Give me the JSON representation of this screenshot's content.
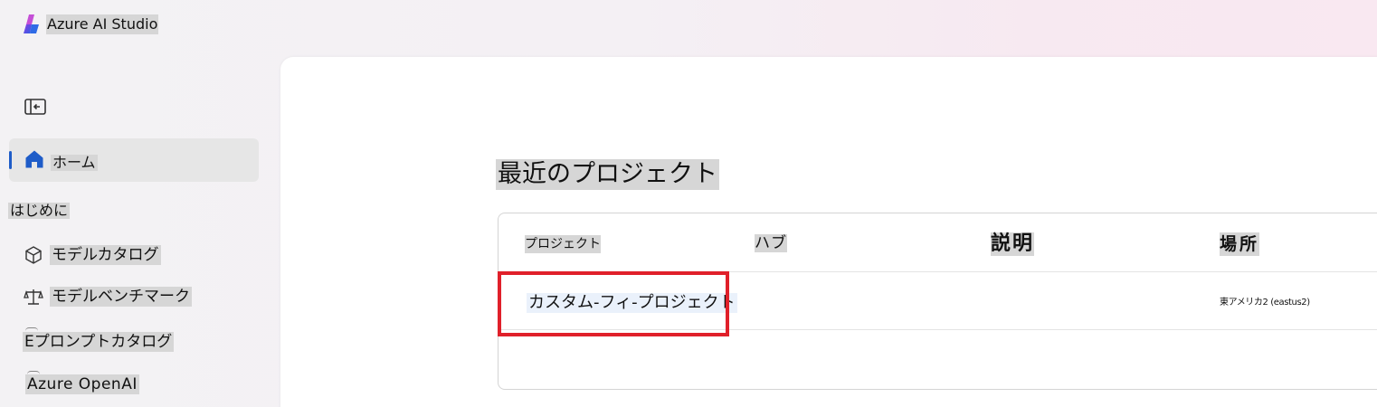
{
  "app": {
    "title": "Azure AI Studio"
  },
  "sidebar": {
    "home_label": "ホーム",
    "section_title": "はじめに",
    "items": [
      {
        "label": "モデルカタログ",
        "icon": "cube-icon"
      },
      {
        "label": "モデルベンチマーク",
        "icon": "scale-icon"
      },
      {
        "label": "Eプロンプトカタログ",
        "icon": "prompt-icon"
      },
      {
        "label": "Azure OpenAI",
        "icon": "openai-icon"
      }
    ]
  },
  "main": {
    "recent_title": "最近のプロジェクト",
    "table": {
      "columns": [
        "プロジェクト",
        "ハブ",
        "説明",
        "場所"
      ],
      "rows": [
        {
          "project": "カスタム-フィ-プロジェクト",
          "hub": "",
          "description": "",
          "location": "東アメリカ2 (eastus2)"
        }
      ]
    }
  },
  "colors": {
    "accent": "#1e5cc8",
    "highlight_border": "#e0202a",
    "nav_active_bg": "#e6e6e6"
  }
}
